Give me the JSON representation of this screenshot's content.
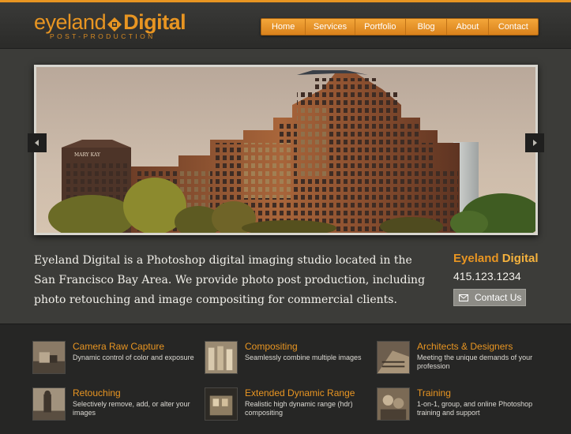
{
  "header": {
    "logo": {
      "word1": "eyeland",
      "word2": "Digital",
      "subtitle": "POST-PRODUCTION"
    },
    "nav": [
      "Home",
      "Services",
      "Portfolio",
      "Blog",
      "About",
      "Contact"
    ]
  },
  "slider": {
    "building_sign": "MARY KAY",
    "prev_icon": "chevron-left-icon",
    "next_icon": "chevron-right-icon"
  },
  "intro": {
    "text": "Eyeland Digital is a Photoshop digital imaging studio located in the San Francisco Bay Area. We provide photo post production, including photo retouching and image compositing for commercial clients."
  },
  "contact": {
    "name_part1": "Eyeland",
    "name_part2": "Digital",
    "phone": "415.123.1234",
    "button_label": "Contact Us",
    "button_icon": "envelope-icon"
  },
  "services": [
    {
      "title": "Camera Raw Capture",
      "desc": "Dynamic control of color and exposure"
    },
    {
      "title": "Compositing",
      "desc": "Seamlessly combine multiple images"
    },
    {
      "title": "Architects & Designers",
      "desc": "Meeting the unique demands of your profession"
    },
    {
      "title": "Retouching",
      "desc": "Selectively remove, add, or alter your images"
    },
    {
      "title": "Extended Dynamic Range",
      "desc": "Realistic high dynamic range (hdr) compositing"
    },
    {
      "title": "Training",
      "desc": "1-on-1, group, and online Photoshop training and support"
    }
  ],
  "colors": {
    "accent": "#e89522",
    "background": "#3c3c39",
    "footer": "#262625"
  }
}
